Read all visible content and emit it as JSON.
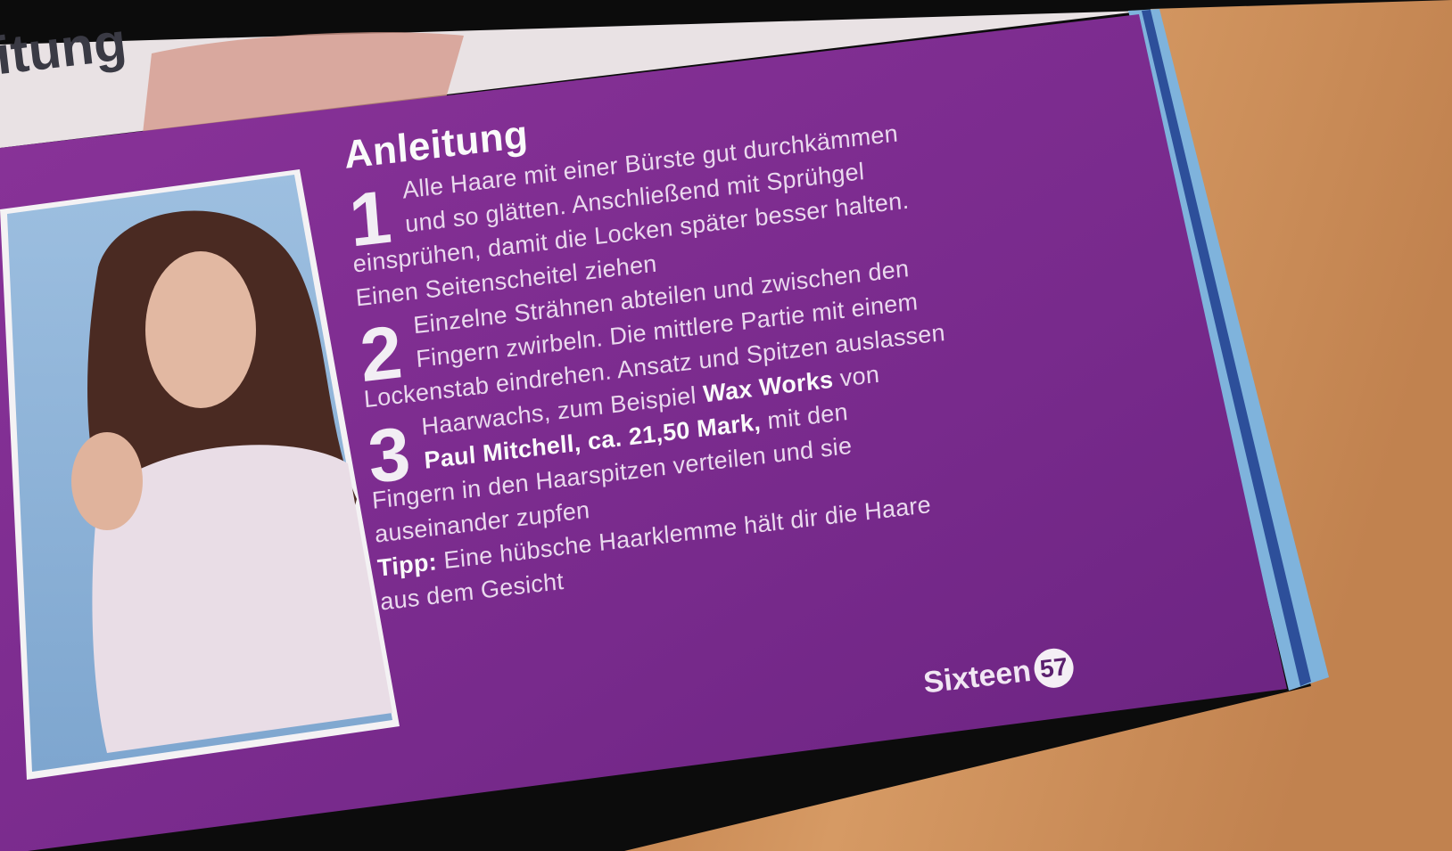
{
  "top_fragment": "itung",
  "article": {
    "heading": "Anleitung",
    "steps": [
      {
        "number": "1",
        "lines": [
          "Alle Haare mit einer Bürste gut durchkämmen",
          "und so glätten. Anschließend mit Sprühgel",
          "einsprühen, damit die Locken später besser halten.",
          "Einen Seitenscheitel ziehen"
        ]
      },
      {
        "number": "2",
        "lines": [
          "Einzelne Strähnen abteilen und zwischen den",
          "Fingern zwirbeln. Die mittlere Partie mit einem",
          "Lockenstab eindrehen. Ansatz und Spitzen auslassen"
        ]
      },
      {
        "number": "3",
        "lines": [
          "Haarwachs, zum Beispiel ",
          "Wax Works",
          " von",
          "Paul Mitchell, ca. 21,50 Mark,",
          " mit den",
          "Fingern in den Haarspitzen verteilen und sie",
          "auseinander zupfen"
        ]
      }
    ],
    "tip_label": "Tipp:",
    "tip_lines": [
      " Eine hübsche Haarklemme hält dir die Haare",
      "aus dem Gesicht"
    ]
  },
  "footer": {
    "magazine": "Sixteen",
    "page_number": "57"
  },
  "colors": {
    "page_purple": "#7a2a8e",
    "photo_blue": "#8fb4d8",
    "wood": "#c98a55"
  }
}
